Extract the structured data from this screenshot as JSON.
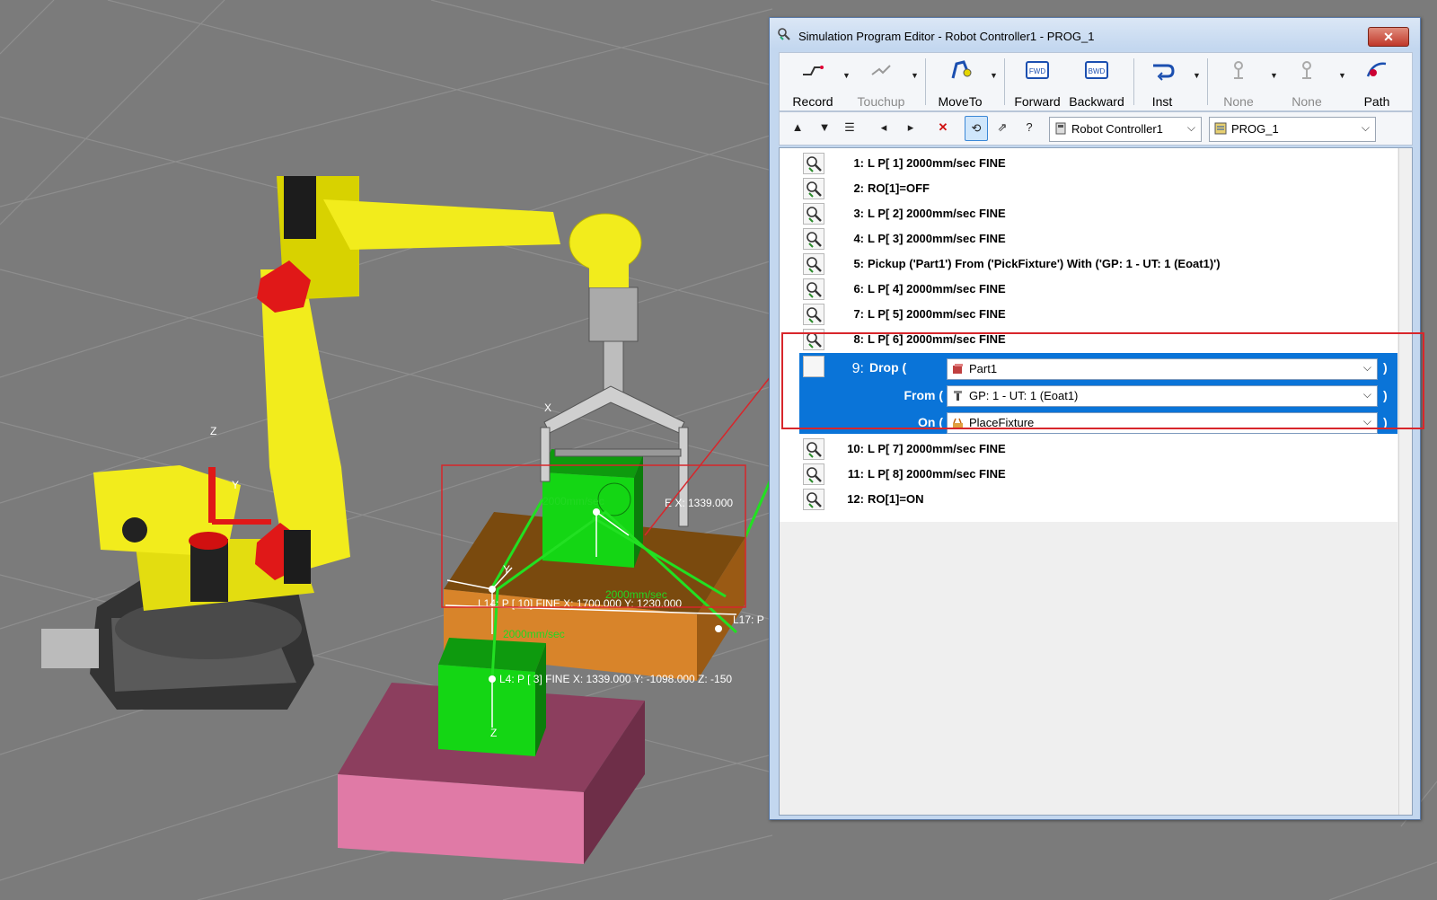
{
  "window": {
    "title": "Simulation Program Editor - Robot Controller1 - PROG_1",
    "close_glyph": "✕"
  },
  "toolbar": {
    "record": "Record",
    "touchup": "Touchup",
    "moveto": "MoveTo",
    "forward": "Forward",
    "backward": "Backward",
    "inst": "Inst",
    "none1": "None",
    "none2": "None",
    "path": "Path",
    "forward_icon_text": "FWD",
    "backward_icon_text": "BWD"
  },
  "toolbar2": {
    "controller_value": "Robot Controller1",
    "program_value": "PROG_1"
  },
  "program": {
    "lines_before": [
      {
        "num": "1:",
        "text": "L P[ 1] 2000mm/sec FINE"
      },
      {
        "num": "2:",
        "text": "RO[1]=OFF"
      },
      {
        "num": "3:",
        "text": "L P[ 2] 2000mm/sec FINE"
      },
      {
        "num": "4:",
        "text": "L P[ 3] 2000mm/sec FINE"
      },
      {
        "num": "5:",
        "text": "Pickup ('Part1') From ('PickFixture') With ('GP: 1 - UT: 1  (Eoat1)')"
      },
      {
        "num": "6:",
        "text": "L P[ 4] 2000mm/sec FINE"
      },
      {
        "num": "7:",
        "text": "L P[ 5] 2000mm/sec FINE"
      },
      {
        "num": "8:",
        "text": "L P[ 6] 2000mm/sec FINE"
      }
    ],
    "selected": {
      "num": "9:",
      "drop_label": "Drop (",
      "from_label": "From (",
      "on_label": "On (",
      "close_paren": ")",
      "part_value": "Part1",
      "tool_value": "GP: 1 - UT: 1  (Eoat1)",
      "fixture_value": "PlaceFixture"
    },
    "lines_after": [
      {
        "num": "10:",
        "text": "L P[ 7] 2000mm/sec FINE"
      },
      {
        "num": "11:",
        "text": "L P[ 8] 2000mm/sec FINE"
      },
      {
        "num": "12:",
        "text": "RO[1]=ON"
      }
    ]
  },
  "scene": {
    "labels": {
      "world_z": "Z",
      "world_y": "Y",
      "speed1": "2000mm/sec",
      "speed2": "2000mm/sec",
      "speed3": "2000mm/sec",
      "l4": "L4: P [  3]   FINE X: 1339.000 Y: -1098.000 Z: -150",
      "l14": "L14: P [  10]   FINE X: 1700.000 Y: 1230.000",
      "l17": "L17: P",
      "ex": "E X: 1339.000",
      "lx": "X",
      "ly": "Y",
      "lz": "Z"
    }
  },
  "colors": {
    "floor": "#7b7b7b",
    "robot_yellow": "#f2ec1c",
    "robot_red": "#e01818",
    "part_green": "#14d614",
    "place_fixture": "#d8842a",
    "pick_fixture": "#e07aa6",
    "selection_blue": "#0a74d8",
    "highlight_red": "#d8262b"
  }
}
